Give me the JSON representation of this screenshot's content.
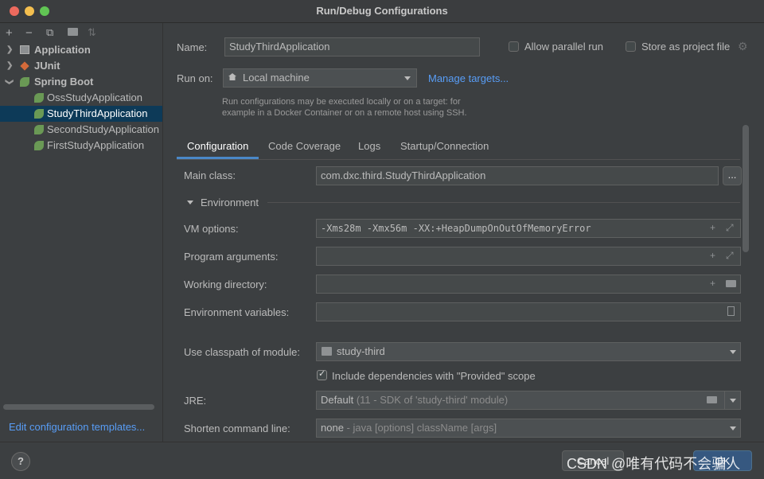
{
  "window": {
    "title": "Run/Debug Configurations"
  },
  "toolbar": {
    "add": "+",
    "remove": "−",
    "copy": "⧉",
    "folder": "▸",
    "sort": "⇅"
  },
  "tree": {
    "groups": [
      {
        "label": "Application"
      },
      {
        "label": "JUnit"
      },
      {
        "label": "Spring Boot"
      }
    ],
    "spring_items": [
      {
        "label": "OssStudyApplication"
      },
      {
        "label": "StudyThirdApplication"
      },
      {
        "label": "SecondStudyApplication"
      },
      {
        "label": "FirstStudyApplication"
      }
    ],
    "edit_templates": "Edit configuration templates..."
  },
  "form": {
    "name_label": "Name:",
    "name_value": "StudyThirdApplication",
    "allow_parallel": "Allow parallel run",
    "store_project": "Store as project file",
    "run_on_label": "Run on:",
    "run_on_value": "Local machine",
    "manage_targets": "Manage targets...",
    "hint_line1": "Run configurations may be executed locally or on a target: for",
    "hint_line2": "example in a Docker Container or on a remote host using SSH."
  },
  "tabs": [
    "Configuration",
    "Code Coverage",
    "Logs",
    "Startup/Connection"
  ],
  "config": {
    "main_class_label": "Main class:",
    "main_class_value": "com.dxc.third.StudyThirdApplication",
    "browse": "...",
    "environment_label": "Environment",
    "vm_label": "VM options:",
    "vm_value": "-Xms28m -Xmx56m -XX:+HeapDumpOnOutOfMemoryError",
    "program_args_label": "Program arguments:",
    "working_dir_label": "Working directory:",
    "env_vars_label": "Environment variables:",
    "classpath_label": "Use classpath of module:",
    "classpath_value": "study-third",
    "include_deps": "Include dependencies with \"Provided\" scope",
    "jre_label": "JRE:",
    "jre_value": "Default",
    "jre_detail": "(11 - SDK of 'study-third' module)",
    "shorten_label": "Shorten command line:",
    "shorten_value": "none",
    "shorten_detail": "- java [options] className [args]"
  },
  "footer": {
    "help": "?",
    "cancel": "Cancel",
    "ok": "OK",
    "watermark": "CSDN @唯有代码不会骗人"
  },
  "colors": {
    "accent": "#365880",
    "link": "#589df6",
    "selection": "#0d3a58"
  }
}
